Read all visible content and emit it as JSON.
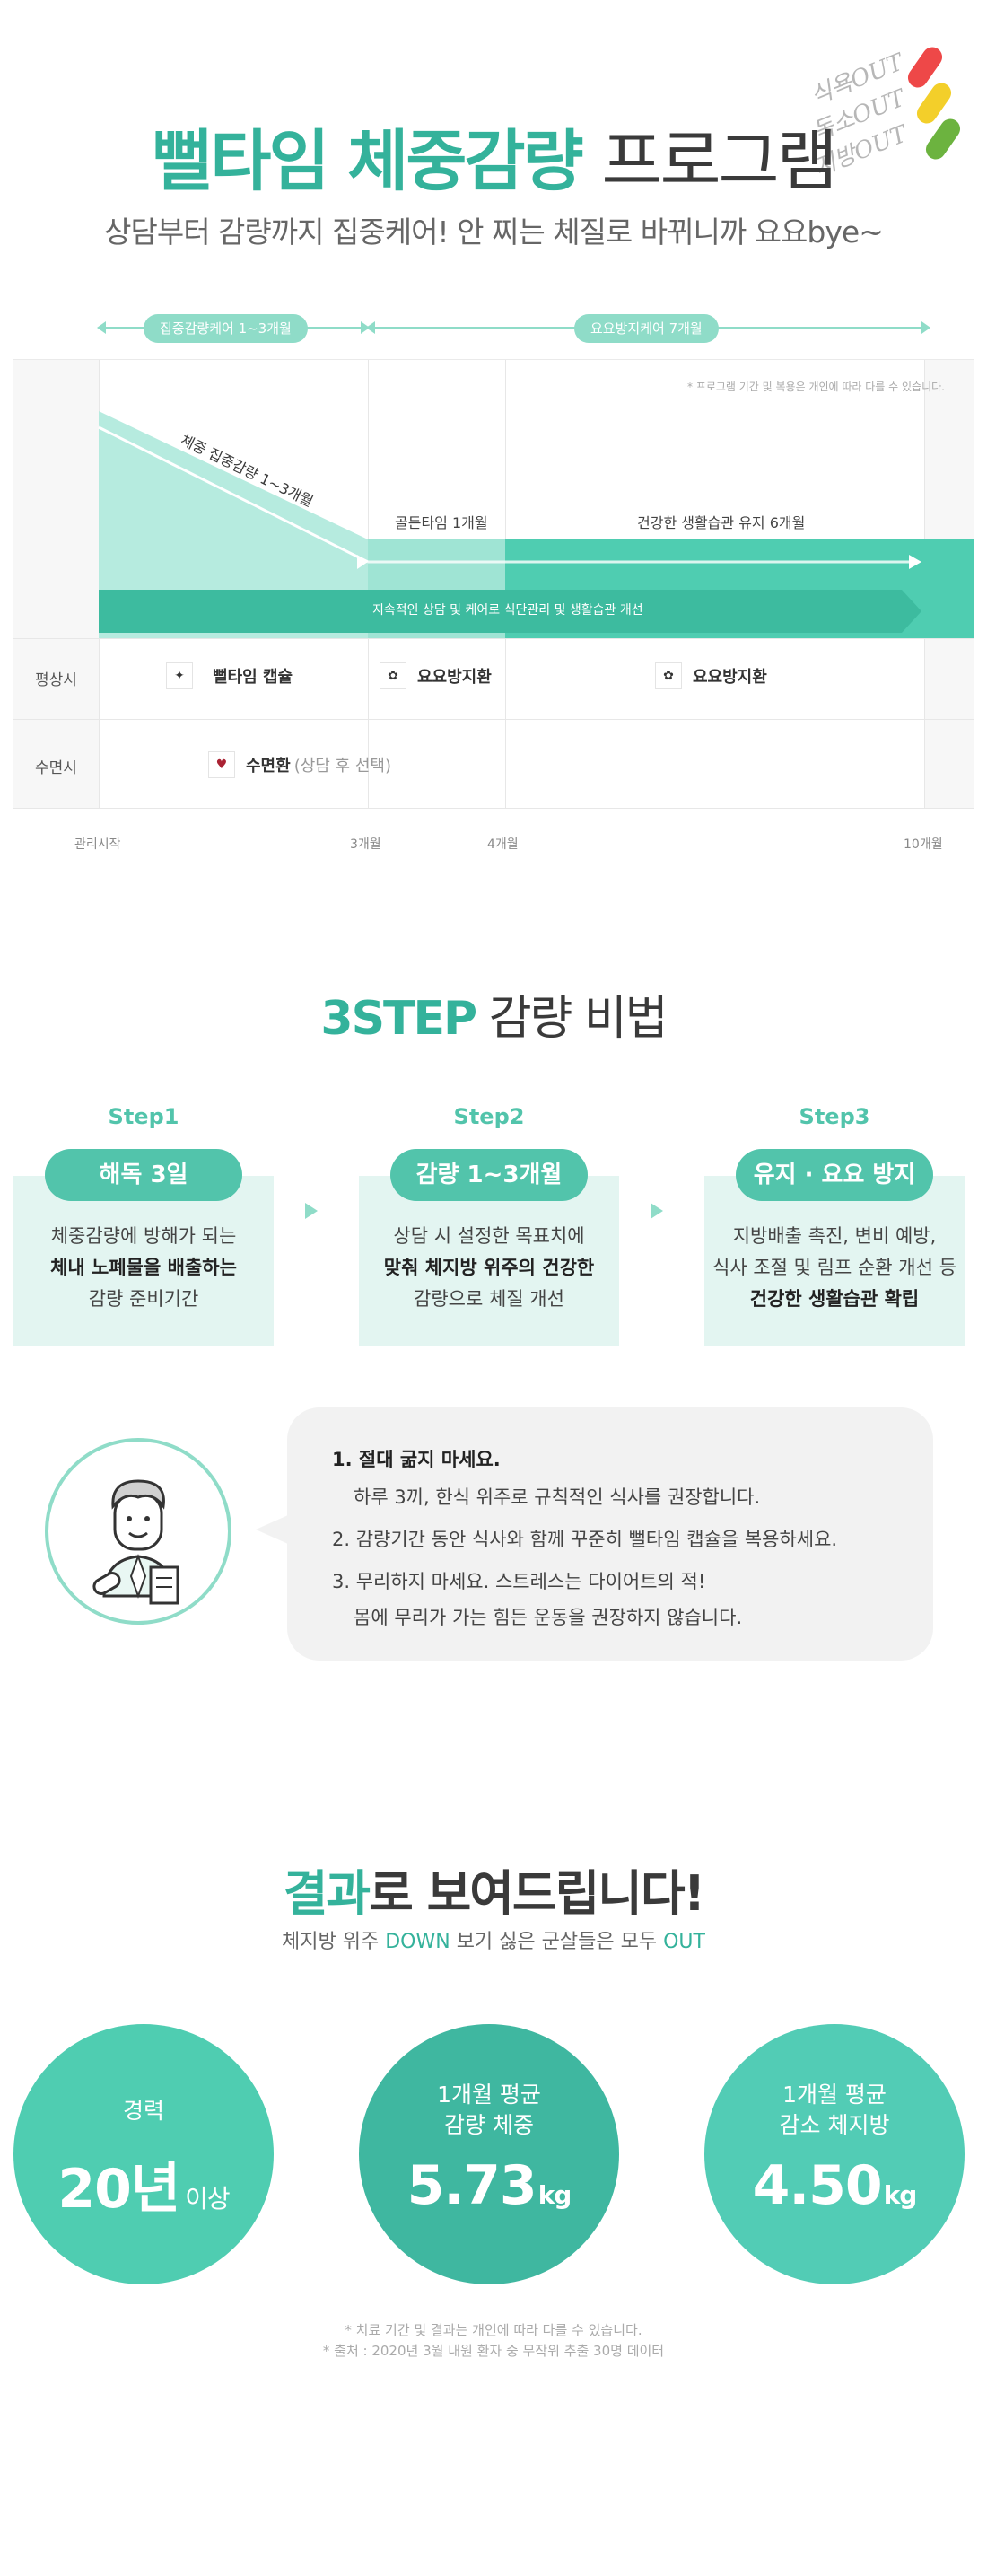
{
  "header": {
    "title_green": "뻘타임 체중감량",
    "title_dark": "프로그램",
    "subtitle": "상담부터 감량까지 집중케어! 안 찌는 체질로 바뀌니까 요요bye~",
    "tags": [
      "식욕OUT",
      "독소OUT",
      "지방OUT"
    ],
    "colors": {
      "accent": "#34b29b",
      "light": "#8fdcc8"
    }
  },
  "timeline": {
    "range1_label": "집중감량케어 1~3개월",
    "range2_label": "요요방지케어 7개월",
    "note": "* 프로그램 기간 및 복용은 개인에 따라 다를 수 있습니다.",
    "diag_label": "체중 집중감량 1~3개월",
    "phase1": "골든타임 1개월",
    "phase2": "건강한 생활습관 유지 6개월",
    "band_text": "지속적인 상담 및 케어로 식단관리 및 생활습관 개선",
    "row1_label": "평상시",
    "row2_label": "수면시",
    "med1": "뻘타임 캡슐",
    "med2": "요요방지환",
    "med3": "요요방지환",
    "med4": "수면환",
    "med4_sub": "(상담 후 선택)",
    "x_labels": [
      "관리시작",
      "3개월",
      "4개월",
      "10개월"
    ]
  },
  "steps": {
    "title_green": "3STEP",
    "title_dark": "감량 비법",
    "items": [
      {
        "label": "Step1",
        "pill": "해독 3일",
        "line1": "체중감량에 방해가 되는",
        "line2": "체내 노폐물을 배출하는",
        "line3": "감량 준비기간"
      },
      {
        "label": "Step2",
        "pill": "감량 1~3개월",
        "line1": "상담 시 설정한 목표치에",
        "line2": "맞춰 체지방 위주의 건강한",
        "line3": "감량으로 체질 개선"
      },
      {
        "label": "Step3",
        "pill": "유지 · 요요 방지",
        "line1": "지방배출 촉진, 변비 예방,",
        "line2": "식사 조절 및 림프 순환 개선 등",
        "line3": "건강한 생활습관 확립"
      }
    ]
  },
  "advice": {
    "t1a": "1. 절대 굶지 마세요.",
    "t1b": "하루 3끼, 한식 위주로 규칙적인 식사를 권장합니다.",
    "t2": "2. 감량기간 동안 식사와 함께 꾸준히 뻘타임 캡슐을 복용하세요.",
    "t3a": "3. 무리하지 마세요. 스트레스는 다이어트의 적!",
    "t3b": "몸에 무리가 가는 힘든 운동을 권장하지 않습니다."
  },
  "results": {
    "title_green": "결과",
    "title_dark": "로 보여드립니다!",
    "sub_a": "체지방 위주 ",
    "sub_g1": "DOWN",
    "sub_b": " 보기 싫은 군살들은 모두 ",
    "sub_g2": "OUT",
    "c1_cap": "경력",
    "c1_val": "20년",
    "c1_unit": "이상",
    "c2_cap1": "1개월 평균",
    "c2_cap2": "감량 체중",
    "c2_val": "5.73",
    "c2_unit": "kg",
    "c3_cap1": "1개월 평균",
    "c3_cap2": "감소 체지방",
    "c3_val": "4.50",
    "c3_unit": "kg",
    "foot1": "* 치료 기간 및 결과는 개인에 따라 다를 수 있습니다.",
    "foot2": "* 출처 : 2020년 3월 내원 환자 중 무작위 추출 30명 데이터",
    "colors": {
      "c1": "#4fcdb1",
      "c2": "#3fb7a0",
      "c3": "#52ccb5"
    }
  }
}
